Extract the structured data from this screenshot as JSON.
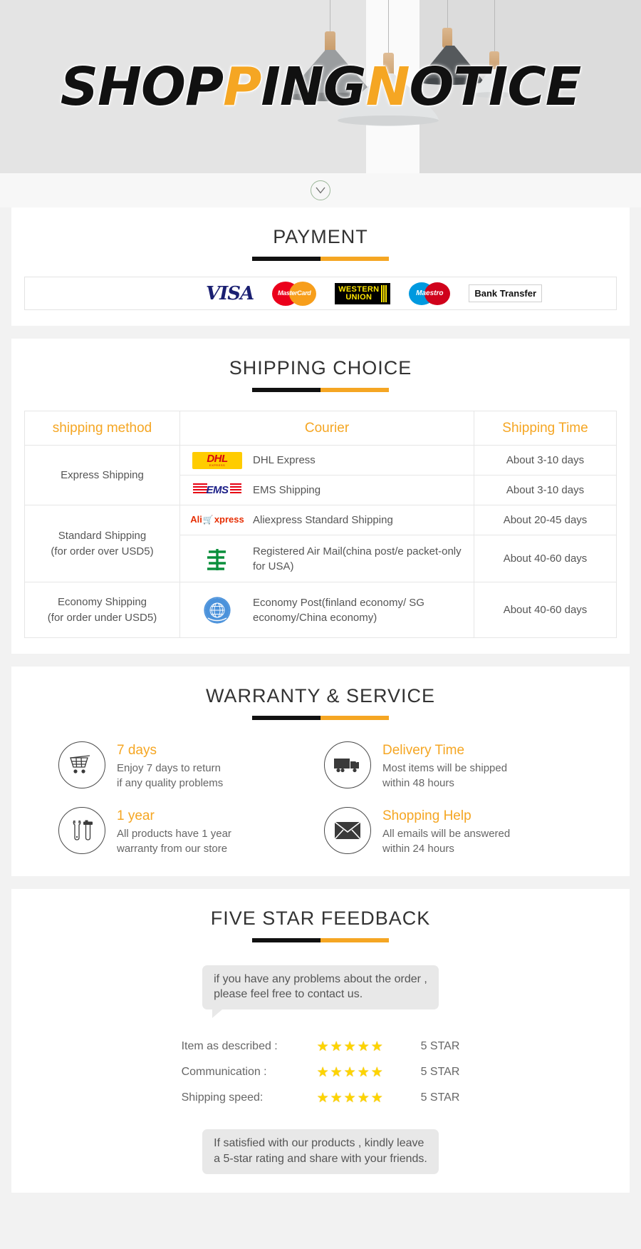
{
  "hero": {
    "title_parts": [
      {
        "text": "SHOP",
        "highlight": false
      },
      {
        "text": "P",
        "highlight": true
      },
      {
        "text": "ING ",
        "highlight": false
      },
      {
        "text": "N",
        "highlight": true
      },
      {
        "text": "OTICE",
        "highlight": false
      }
    ],
    "title_plain": "SHOPPING NOTICE"
  },
  "divider": {
    "icon": "chevron-down-icon"
  },
  "colors": {
    "accent_orange": "#f5a623",
    "rule_black": "#111111",
    "text_gray": "#666666",
    "panel_bg": "#ffffff",
    "page_bg": "#f2f2f2"
  },
  "payment": {
    "title": "PAYMENT",
    "methods": [
      {
        "name": "visa-logo",
        "label": "VISA"
      },
      {
        "name": "mastercard-logo",
        "label": "MasterCard"
      },
      {
        "name": "western-union-logo",
        "label_line1": "WESTERN",
        "label_line2": "UNION"
      },
      {
        "name": "maestro-logo",
        "label": "Maestro"
      },
      {
        "name": "bank-transfer-logo",
        "label": "Bank Transfer"
      }
    ]
  },
  "shipping": {
    "title": "SHIPPING CHOICE",
    "headers": [
      "shipping method",
      "Courier",
      "Shipping Time"
    ],
    "groups": [
      {
        "method": "Express Shipping",
        "rows": [
          {
            "logo": "dhl-logo",
            "courier": "DHL Express",
            "time": "About 3-10 days"
          },
          {
            "logo": "ems-logo",
            "courier": "EMS Shipping",
            "time": "About 3-10 days"
          }
        ]
      },
      {
        "method": "Standard Shipping\n(for order over USD5)",
        "method_line1": "Standard Shipping",
        "method_line2": "(for order over USD5)",
        "rows": [
          {
            "logo": "aliexpress-logo",
            "courier": "Aliexpress Standard Shipping",
            "time": "About 20-45 days"
          },
          {
            "logo": "china-post-logo",
            "courier": "Registered Air Mail(china post/e packet-only for USA)",
            "time": "About 40-60 days"
          }
        ]
      },
      {
        "method": "Economy Shipping\n(for order under USD5)",
        "method_line1": "Economy Shipping",
        "method_line2": "(for order under USD5)",
        "rows": [
          {
            "logo": "un-post-logo",
            "courier": "Economy Post(finland economy/ SG economy/China economy)",
            "time": "About 40-60 days"
          }
        ]
      }
    ]
  },
  "warranty": {
    "title": "WARRANTY & SERVICE",
    "items": [
      {
        "icon": "shopping-cart-icon",
        "heading": "7  days",
        "desc_line1": "Enjoy 7 days to return",
        "desc_line2": "if any quality problems"
      },
      {
        "icon": "truck-icon",
        "heading": "Delivery Time",
        "desc_line1": "Most items will be shipped",
        "desc_line2": "within 48 hours"
      },
      {
        "icon": "tools-icon",
        "heading": "1 year",
        "desc_line1": "All products have 1 year",
        "desc_line2": "warranty from our store"
      },
      {
        "icon": "envelope-icon",
        "heading": "Shopping Help",
        "desc_line1": "All emails will be answered",
        "desc_line2": "within 24 hours"
      }
    ]
  },
  "feedback": {
    "title": "FIVE STAR FEEDBACK",
    "top_bubble_line1": "if you have any problems about the order ,",
    "top_bubble_line2": "please feel free to contact us.",
    "ratings": [
      {
        "label": "Item as described :",
        "stars": 5,
        "value": "5 STAR"
      },
      {
        "label": "Communication :",
        "stars": 5,
        "value": "5 STAR"
      },
      {
        "label": "Shipping speed:",
        "stars": 5,
        "value": "5 STAR"
      }
    ],
    "bottom_bubble_line1": "If satisfied with our products ,  kindly leave",
    "bottom_bubble_line2": "a 5-star rating and share with your friends."
  }
}
